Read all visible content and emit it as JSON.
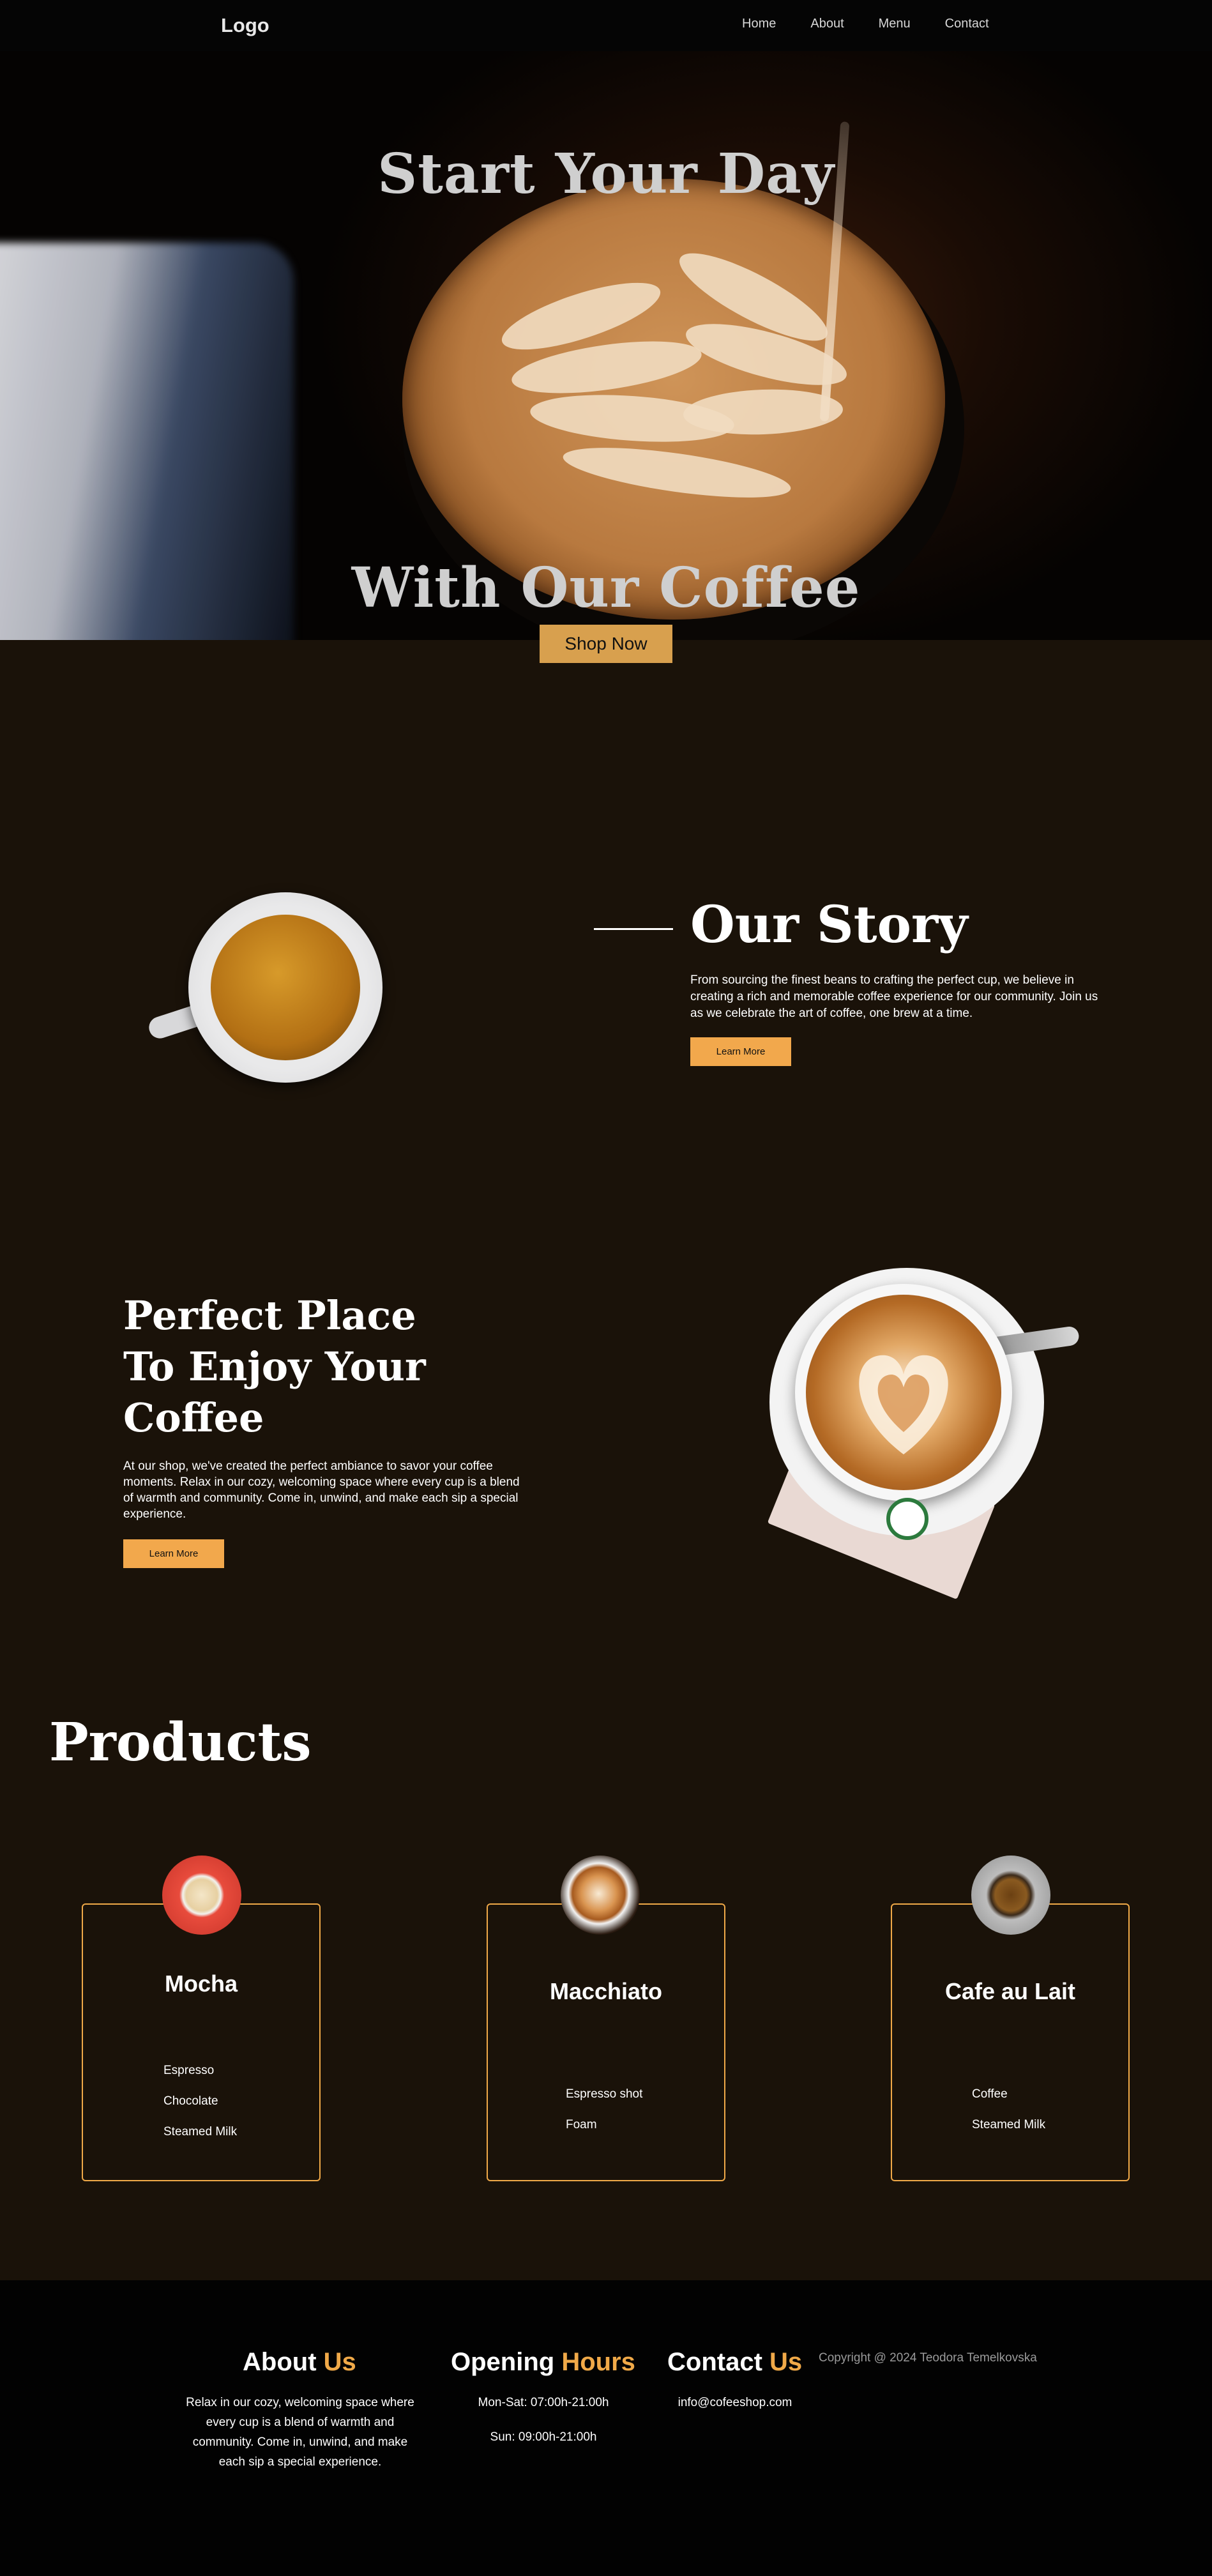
{
  "nav": {
    "logo": "Logo",
    "links": [
      "Home",
      "About",
      "Menu",
      "Contact"
    ]
  },
  "hero": {
    "title_line1": "Start Your Day",
    "title_line2": "With Our Coffee",
    "cta": "Shop Now"
  },
  "story": {
    "title": "Our Story",
    "text": "From sourcing the finest beans to crafting the perfect cup, we believe in creating a rich and memorable coffee experience for our community. Join us as we celebrate the art of coffee, one brew at a time.",
    "button": "Learn More"
  },
  "place": {
    "title_lines": [
      "Perfect Place",
      "To Enjoy Your",
      "Coffee"
    ],
    "text": "At our shop, we've created the perfect ambiance to savor your coffee moments. Relax in our cozy, welcoming space where every cup is a blend of warmth and community. Come in, unwind, and make each sip a special experience.",
    "button": "Learn More"
  },
  "products": {
    "title": "Products",
    "items": [
      {
        "name": "Mocha",
        "ingredients": [
          "Espresso",
          "Chocolate",
          "Steamed Milk"
        ]
      },
      {
        "name": "Macchiato",
        "ingredients": [
          "Espresso shot",
          "Foam"
        ]
      },
      {
        "name": "Cafe au Lait",
        "ingredients": [
          "Coffee",
          "Steamed Milk"
        ]
      }
    ]
  },
  "footer": {
    "about": {
      "head_main": "About",
      "head_accent": "Us",
      "text": "Relax in our cozy, welcoming space where every cup is a blend of warmth and community. Come in, unwind, and make each sip a special experience."
    },
    "hours": {
      "head_main": "Opening",
      "head_accent": "Hours",
      "line1": "Mon-Sat: 07:00h-21:00h",
      "line2": "Sun: 09:00h-21:00h"
    },
    "contact": {
      "head_main": "Contact",
      "head_accent": "Us",
      "email": "info@cofeeshop.com"
    },
    "copyright": "Copyright @ 2024 Teodora Temelkovska"
  },
  "colors": {
    "accent": "#f0a948",
    "background": "#1a1209",
    "footer_bg": "#020202"
  }
}
